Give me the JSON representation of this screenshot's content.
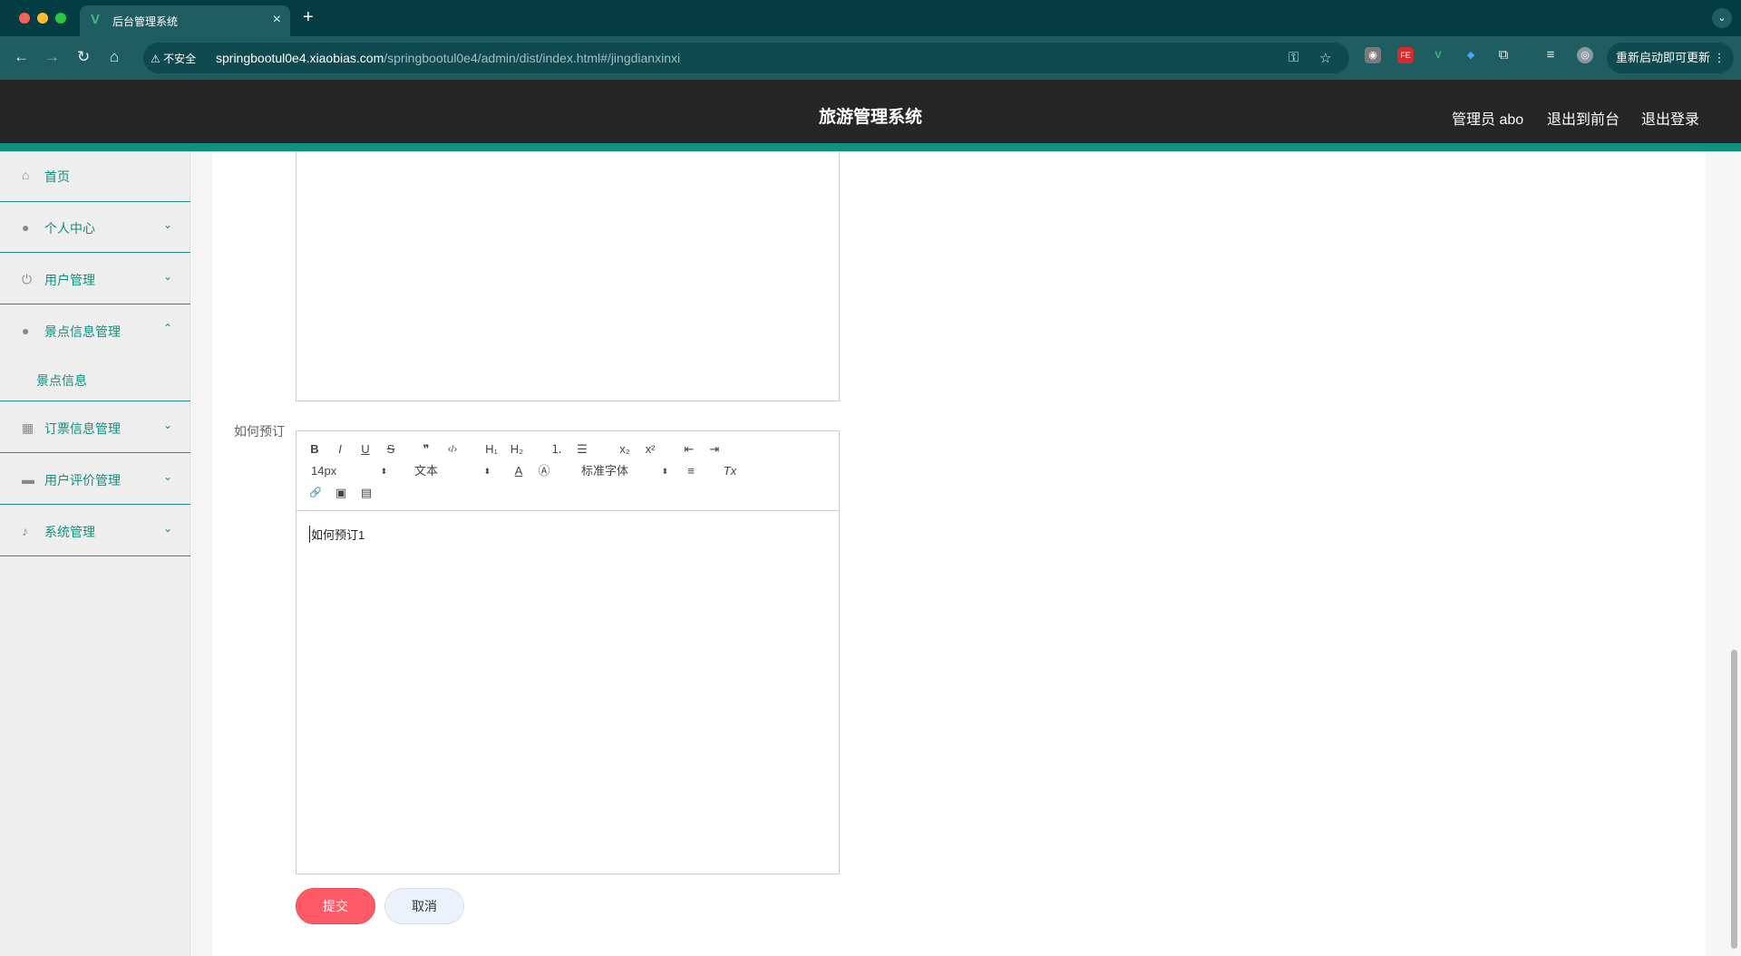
{
  "browser": {
    "tab_title": "后台管理系统",
    "tab_favicon": "V",
    "tab_close": "×",
    "new_tab": "+",
    "insecure_label": "不安全",
    "url_host": "springbootul0e4.xiaobias.com",
    "url_path": "/springbootul0e4/admin/dist/index.html#/jingdianxinxi",
    "update_button": "重新启动即可更新",
    "nav_icons": [
      "back-icon",
      "forward-icon",
      "reload-icon",
      "home-icon"
    ],
    "extensions": [
      {
        "icon": "owl-extension-icon",
        "text": "◉",
        "color": "#7a7a7a"
      },
      {
        "icon": "fe-extension-icon",
        "text": "FE",
        "color": "#d62b2b"
      },
      {
        "icon": "vue-devtools-icon",
        "text": "V",
        "color": "#41b883"
      },
      {
        "icon": "gem-extension-icon",
        "text": "◆",
        "color": "#2f80ed"
      },
      {
        "icon": "puzzle-extensions-icon",
        "text": "⧉",
        "color": "#1f5d62"
      },
      {
        "icon": "media-control-icon",
        "text": "≡",
        "color": "#1f5d62"
      },
      {
        "icon": "profile-avatar-icon",
        "text": "◎",
        "color": "#8a9aa0"
      }
    ]
  },
  "header": {
    "title": "旅游管理系统",
    "user": "管理员 abo",
    "to_frontend": "退出到前台",
    "logout": "退出登录"
  },
  "sidebar": {
    "items": [
      {
        "label": "首页",
        "icon": "home-icon",
        "glyph": "⌂",
        "arrow": ""
      },
      {
        "label": "个人中心",
        "icon": "user-icon",
        "glyph": "●",
        "arrow": "⌄"
      },
      {
        "label": "用户管理",
        "icon": "power-icon",
        "glyph": "⏻",
        "arrow": "⌄"
      },
      {
        "label": "景点信息管理",
        "icon": "user-icon",
        "glyph": "●",
        "arrow": "⌃"
      },
      {
        "label": "订票信息管理",
        "icon": "grid-icon",
        "glyph": "▦",
        "arrow": "⌄"
      },
      {
        "label": "用户评价管理",
        "icon": "book-icon",
        "glyph": "▬",
        "arrow": "⌄"
      },
      {
        "label": "系统管理",
        "icon": "microphone-icon",
        "glyph": "♪",
        "arrow": "⌄"
      }
    ],
    "submenu": {
      "label": "景点信息"
    }
  },
  "form": {
    "booking_label": "如何预订",
    "editor_content": "如何预订1",
    "toolbar": {
      "bold": "B",
      "italic": "I",
      "underline": "U",
      "strike": "S",
      "blockquote": "❞",
      "code": "‹/›",
      "h1": "H₁",
      "h2": "H₂",
      "ordered_list": "⒈",
      "bullet_list": "☰",
      "subscript": "x₂",
      "superscript": "x²",
      "outdent": "⇤",
      "indent": "⇥",
      "font_size": "14px",
      "header_select": "文本",
      "font_color": "A",
      "background_color": "Ⓐ",
      "font_family": "标准字体",
      "align": "≡",
      "clean": "Tx",
      "link": "🔗",
      "image": "▣",
      "video": "▤",
      "caret": "⬍"
    },
    "submit": "提交",
    "cancel": "取消"
  }
}
